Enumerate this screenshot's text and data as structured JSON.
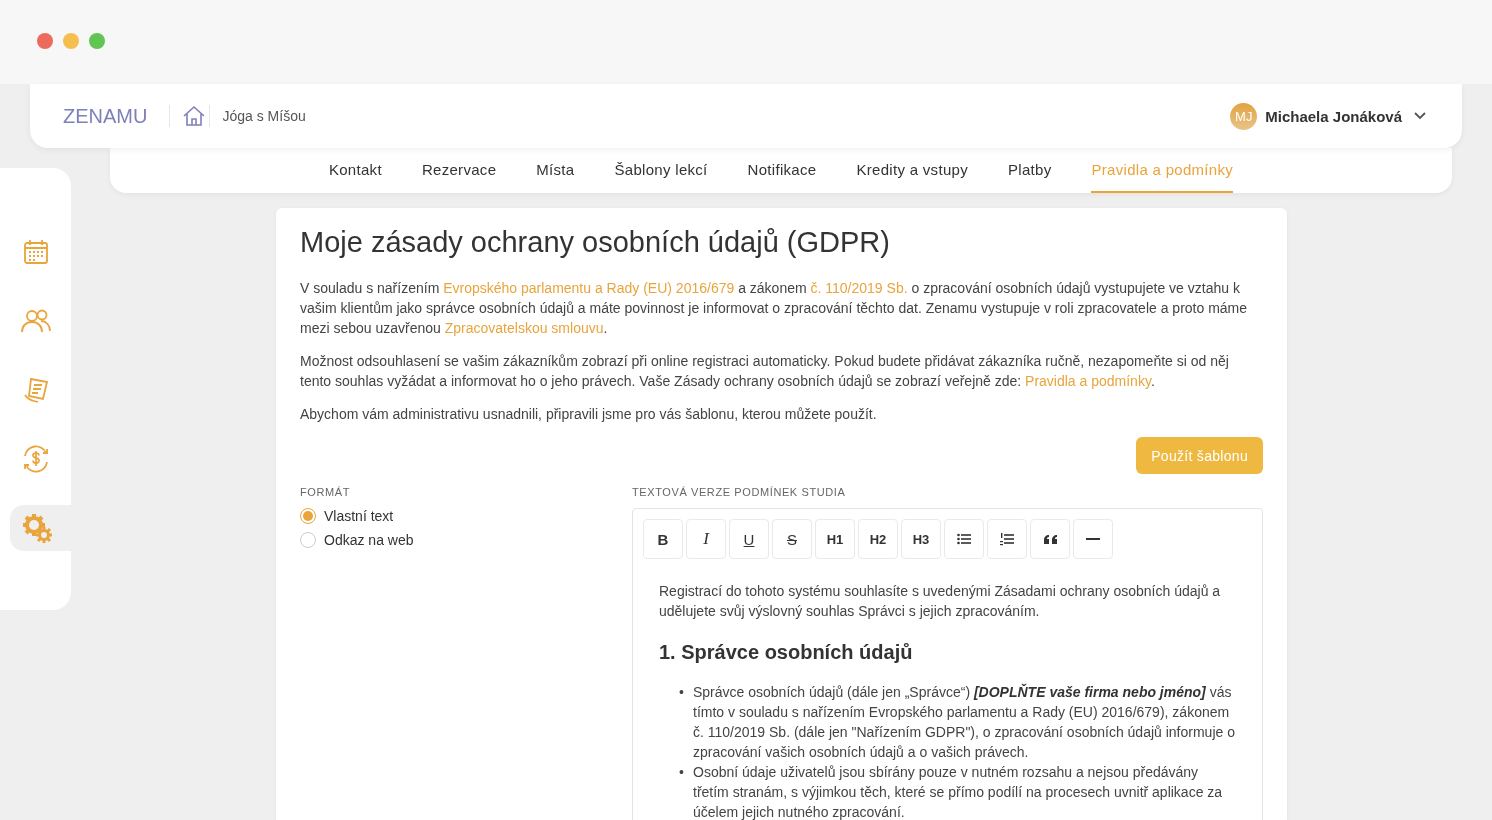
{
  "header": {
    "logo": "ZENAMU",
    "studio": "Jóga s Míšou",
    "user": {
      "initials": "MJ",
      "name": "Michaela Jonáková"
    }
  },
  "sidebar": {
    "items": [
      {
        "selected": false
      },
      {
        "selected": false
      },
      {
        "selected": false
      },
      {
        "selected": false
      },
      {
        "selected": true
      }
    ]
  },
  "tabs": [
    {
      "label": "Kontakt",
      "selected": false
    },
    {
      "label": "Rezervace",
      "selected": false
    },
    {
      "label": "Místa",
      "selected": false
    },
    {
      "label": "Šablony lekcí",
      "selected": false
    },
    {
      "label": "Notifikace",
      "selected": false
    },
    {
      "label": "Kredity a vstupy",
      "selected": false
    },
    {
      "label": "Platby",
      "selected": false
    },
    {
      "label": "Pravidla a podmínky",
      "selected": true
    }
  ],
  "content": {
    "title": "Moje zásady ochrany osobních údajů (GDPR)",
    "paragraphs": [
      [
        {
          "text": "V souladu s nařízením ",
          "link": false
        },
        {
          "text": "Evropského parlamentu a Rady (EU) 2016/679",
          "link": true
        },
        {
          "text": " a zákonem ",
          "link": false
        },
        {
          "text": "č. 110/2019 Sb.",
          "link": true
        },
        {
          "text": " o zpracování osobních údajů vystupujete ve vztahu k vašim klientům jako správce osobních údajů a máte povinnost je informovat o zpracování těchto dat. Zenamu vystupuje v roli zpracovatele a proto máme mezi sebou uzavřenou ",
          "link": false
        },
        {
          "text": "Zpracovatelskou smlouvu",
          "link": true
        },
        {
          "text": ".",
          "link": false
        }
      ],
      [
        {
          "text": "Možnost odsouhlasení se vašim zákazníkům zobrazí při online registraci automaticky. Pokud budete přidávat zákazníka ručně, nezapomeňte si od něj tento souhlas vyžádat a informovat ho o jeho právech. Vaše Zásady ochrany osobních údajů se zobrazí veřejně zde: ",
          "link": false
        },
        {
          "text": "Pravidla a podmínky",
          "link": true
        },
        {
          "text": ".",
          "link": false
        }
      ],
      [
        {
          "text": "Abychom vám administrativu usnadnili, připravili jsme pro vás šablonu, kterou můžete použít.",
          "link": false
        }
      ]
    ],
    "template_button": "Použít šablonu",
    "format": {
      "label": "FORMÁT",
      "options": [
        {
          "label": "Vlastní text",
          "selected": true
        },
        {
          "label": "Odkaz na web",
          "selected": false
        }
      ]
    },
    "editor": {
      "label": "TEXTOVÁ VERZE PODMÍNEK STUDIA",
      "toolbar": [
        {
          "kind": "bold",
          "label": "B"
        },
        {
          "kind": "italic",
          "label": "I"
        },
        {
          "kind": "underline",
          "label": "U"
        },
        {
          "kind": "strike",
          "label": "S"
        },
        {
          "kind": "heading",
          "label": "H1"
        },
        {
          "kind": "heading",
          "label": "H2"
        },
        {
          "kind": "heading",
          "label": "H3"
        },
        {
          "kind": "bullet-list"
        },
        {
          "kind": "numbered-list"
        },
        {
          "kind": "quote"
        },
        {
          "kind": "rule"
        }
      ],
      "intro": "Registrací do tohoto systému souhlasíte s uvedenými Zásadami ochrany osobních údajů a udělujete svůj výslovný souhlas Správci s jejich zpracováním.",
      "heading": "1. Správce osobních údajů",
      "bullets": [
        {
          "marker": "•",
          "text": "Správce osobních údajů (dále jen „Správce“) **[DOPLŇTE vaše firma nebo jméno]** vás tímto v souladu s nařízením Evropského parlamentu a Rady (EU) 2016/679), zákonem č. 110/2019 Sb. (dále jen \"Nařízením GDPR\"), o zpracování osobních údajů informuje o zpracování vašich osobních údajů a o vašich právech."
        },
        {
          "marker": "•",
          "text": "Osobní údaje uživatelů jsou sbírány pouze v nutném rozsahu a nejsou předávány třetím stranám, s výjimkou těch, které se přímo podílí na procesech uvnitř aplikace za účelem jejich nutného zpracování."
        }
      ]
    }
  }
}
